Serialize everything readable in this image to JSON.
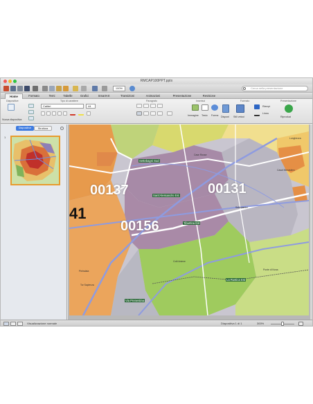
{
  "window": {
    "title": "RMCAP100PPT.pptx",
    "search_placeholder": "Cerca nella presentazione",
    "zoom": "100%"
  },
  "tabs": [
    "Home",
    "Formato",
    "Temi",
    "Tabelle",
    "Grafici",
    "SmartArt",
    "Transizioni",
    "Animazioni",
    "Presentazione",
    "Revisione"
  ],
  "ribbon": {
    "groups": [
      "Diapositive",
      "Tipo di carattere",
      "Paragrafo",
      "Inserisci",
      "Formato",
      "Presentazione"
    ],
    "new_slide_label": "Nuova diapositiva",
    "font_name": "Calibri",
    "font_size": "44",
    "insert_labels": [
      "Immagine",
      "Testo",
      "Forma"
    ],
    "format_labels": [
      "Disponi",
      "Stili veloci",
      "Riempi",
      "Linea"
    ],
    "present_label": "Riproduci"
  },
  "sidebar": {
    "tabs": [
      "Diapositive",
      "Struttura"
    ],
    "slide_number": "1"
  },
  "map": {
    "zip_codes": [
      "00137",
      "00131",
      "00156",
      "41"
    ],
    "stations": [
      "Settebagni Sud",
      "Sant'Alessandro Est",
      "Tiburtina Est",
      "La Rustica Est",
      "Via Prenestina"
    ],
    "labels": [
      "Settecamini",
      "Casal Monastero",
      "Lunghezza",
      "Ponte di Nona",
      "Tor Sapienza",
      "Colli Aniene",
      "Pietralata",
      "Case Rosse"
    ],
    "colors": {
      "zone_00137": "#a98aa6",
      "zone_00131": "#b9b5bf",
      "zone_00156": "#a989a7",
      "zone_west": "#e9a15a",
      "zone_green": "#9fcb5e",
      "zone_yellow": "#f2e49a",
      "zone_orange": "#e9964a",
      "roads": "#ffffff",
      "highways": "#8e9be0"
    }
  },
  "status": {
    "view_label": "Visualizzazione normale",
    "slide_indicator": "Diapositiva 1 di 1",
    "zoom_percent": "300%"
  }
}
